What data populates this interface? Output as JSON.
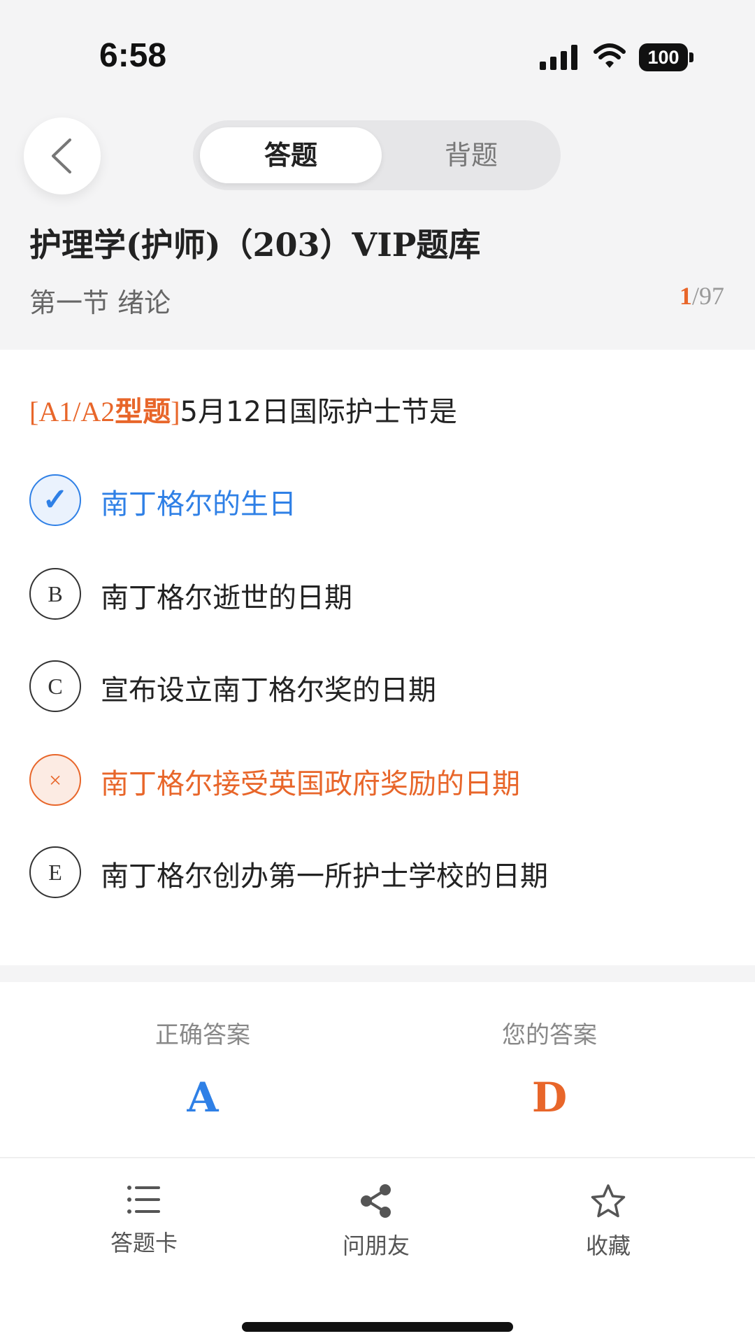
{
  "status_bar": {
    "time": "6:58",
    "battery": "100"
  },
  "header": {
    "tabs": [
      {
        "label": "答题",
        "active": true
      },
      {
        "label": "背题",
        "active": false
      }
    ],
    "bank_title": "护理学(护师)（203）VIP题库",
    "section_title": "第一节 绪论",
    "progress_current": "1",
    "progress_total": "/97"
  },
  "question": {
    "type_prefix": "[A1/A2",
    "type_word": "型题",
    "type_suffix": "]",
    "text": "5月12日国际护士节是",
    "options": [
      {
        "marker": "✓",
        "text": "南丁格尔的生日",
        "state": "correct"
      },
      {
        "marker": "B",
        "text": "南丁格尔逝世的日期",
        "state": "normal"
      },
      {
        "marker": "C",
        "text": "宣布设立南丁格尔奖的日期",
        "state": "normal"
      },
      {
        "marker": "×",
        "text": "南丁格尔接受英国政府奖励的日期",
        "state": "wrong"
      },
      {
        "marker": "E",
        "text": "南丁格尔创办第一所护士学校的日期",
        "state": "normal"
      }
    ]
  },
  "answers": {
    "correct_label": "正确答案",
    "correct_value": "A",
    "yours_label": "您的答案",
    "yours_value": "D"
  },
  "bottom_nav": [
    {
      "label": "答题卡",
      "icon": "list-icon"
    },
    {
      "label": "问朋友",
      "icon": "share-icon"
    },
    {
      "label": "收藏",
      "icon": "star-icon"
    }
  ],
  "colors": {
    "accent_blue": "#2f80e6",
    "accent_orange": "#e8662a"
  }
}
